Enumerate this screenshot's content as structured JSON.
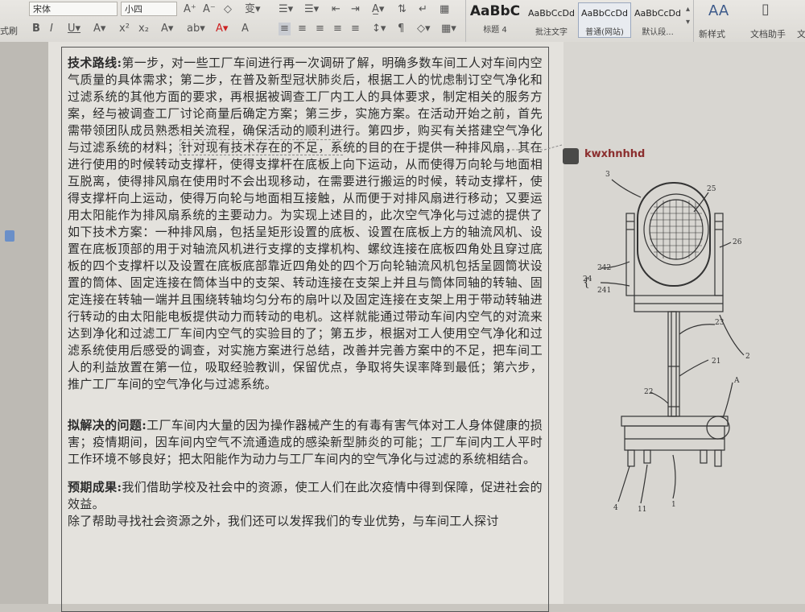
{
  "ribbon": {
    "left_cut": "式刷",
    "font_name": "宋体",
    "font_size": "小四",
    "styles": [
      {
        "preview": "AaBbC",
        "name": "标题 4"
      },
      {
        "preview": "AaBbCcDd",
        "name": "批注文字"
      },
      {
        "preview": "AaBbCcDd",
        "name": "普通(网站)"
      },
      {
        "preview": "AaBbCcDd",
        "name": "默认段..."
      }
    ],
    "new_style": "新样式",
    "doc_helper": "文档助手",
    "cut_right": "文"
  },
  "comment": {
    "author": "kwxhnhhd"
  },
  "content": {
    "p1_label": "技术路线:",
    "p1_text_a": "第一步，对一些工厂车间进行再一次调研了解，明确多数车间工人对车间内空气质量的具体需求；第二步，在普及新型冠状肺炎后，根据工人的忧虑制订空气净化和过滤系统的其他方面的要求，再根据被调查工厂内工人的具体要求，制定相关的服务方案，经与被调查工厂讨论商量后确定方案；第三步，实施方案。在活动开始之前，首先需带领团队成员熟悉相关流程，确保活动的顺利进行。第四步，购买有关搭建空气净化与过滤系统的材料；",
    "p1_highlight": "针对现有技术存在的不足，系",
    "p1_text_b": "统的目的在于提供一种排风扇，其在进行使用的时候转动支撑杆，使得支撑杆在底板上向下运动，从而使得万向轮与地面相互脱离，使得排风扇在使用时不会出现移动，在需要进行搬运的时候，转动支撑杆，使得支撑杆向上运动，使得万向轮与地面相互接触，从而便于对排风扇进行移动；又要运用太阳能作为排风扇系统的主要动力。为实现上述目的，此次空气净化与过滤的提供了如下技术方案：一种排风扇，包括呈矩形设置的底板、设置在底板上方的轴流风机、设置在底板顶部的用于对轴流风机进行支撑的支撑机构、螺纹连接在底板四角处且穿过底板的四个支撑杆以及设置在底板底部靠近四角处的四个万向轮轴流风机包括呈圆筒状设置的筒体、固定连接在筒体当中的支架、转动连接在支架上并且与筒体同轴的转轴、固定连接在转轴一端并且围绕转轴均匀分布的扇叶以及固定连接在支架上用于带动转轴进行转动的由太阳能电板提供动力而转动的电机。这样就能通过带动车间内空气的对流来达到净化和过滤工厂车间内空气的实验目的了；第五步，根据对工人使用空气净化和过滤系统使用后感受的调查，对实施方案进行总结，改善并完善方案中的不足，把车间工人的利益放置在第一位，吸取经验教训，保留优点，争取将失误率降到最低；第六步，推广工厂车间的空气净化与过滤系统。",
    "p2_label": "拟解决的问题:",
    "p2_text": "工厂车间内大量的因为操作器械产生的有毒有害气体对工人身体健康的损害；疫情期间，因车间内空气不流通造成的感染新型肺炎的可能；工厂车间内工人平时工作环境不够良好；把太阳能作为动力与工厂车间内的空气净化与过滤的系统相结合。",
    "p3_label": "预期成果:",
    "p3_text": "我们借助学校及社会中的资源，使工人们在此次疫情中得到保障，促进社会的效益。",
    "p4_text": "除了帮助寻找社会资源之外，我们还可以发挥我们的专业优势，与车间工人探讨"
  },
  "figure": {
    "labels": [
      "3",
      "25",
      "26",
      "242",
      "24",
      "241",
      "23",
      "2",
      "21",
      "22",
      "A",
      "4",
      "11",
      "1"
    ]
  }
}
